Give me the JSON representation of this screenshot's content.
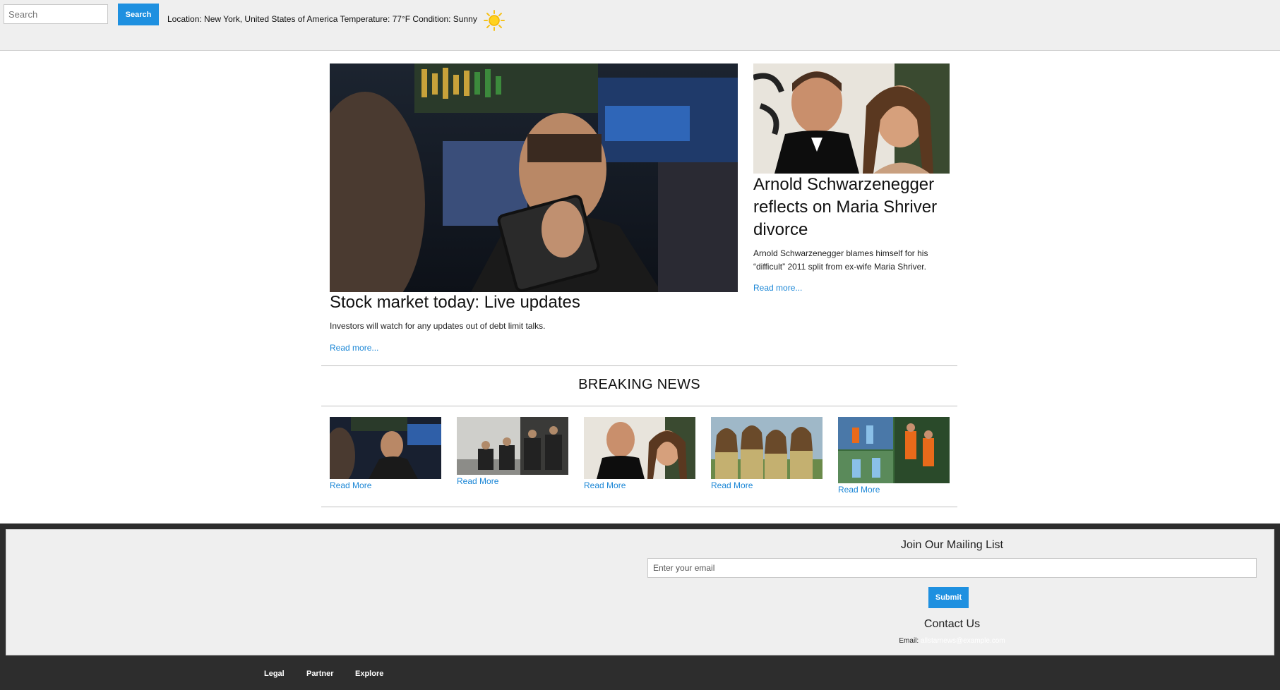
{
  "header": {
    "search_placeholder": "Search",
    "search_button": "Search",
    "weather_text": "Location: New York, United States of America Temperature: 77°F Condition: Sunny",
    "weather_icon": "sun-icon"
  },
  "main_story": {
    "title": "Stock market today: Live updates",
    "description": "Investors will watch for any updates out of debt limit talks.",
    "read_more": "Read more..."
  },
  "side_story": {
    "title": "Arnold Schwarzenegger reflects on Maria Shriver divorce",
    "description": "Arnold Schwarzenegger blames himself for his “difficult” 2011 split from ex-wife Maria Shriver.",
    "read_more": "Read more..."
  },
  "breaking": {
    "title": "BREAKING NEWS",
    "items": [
      {
        "read_more": "Read More"
      },
      {
        "read_more": "Read More"
      },
      {
        "read_more": "Read More"
      },
      {
        "read_more": "Read More"
      },
      {
        "read_more": "Read More"
      }
    ]
  },
  "footer": {
    "mailing_title": "Join Our Mailing List",
    "email_placeholder": "Enter your email",
    "submit_label": "Submit",
    "contact_title": "Contact Us",
    "email_label": "Email:",
    "email_value": "allstarnews@example.com",
    "links": [
      "Legal",
      "Partner",
      "Explore"
    ]
  },
  "colors": {
    "accent": "#1e90e0",
    "link": "#1a86d6",
    "footer_bg": "#2d2d2d",
    "topbar_bg": "#efefef"
  }
}
